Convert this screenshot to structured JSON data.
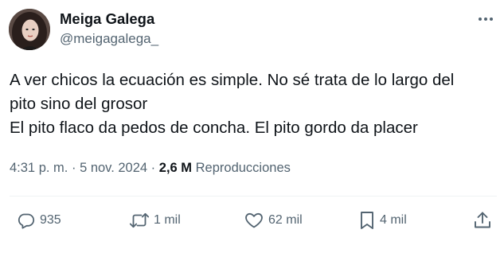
{
  "author": {
    "display_name": "Meiga Galega",
    "handle": "@meigagalega_"
  },
  "post": {
    "lines": [
      "A ver chicos la ecuación es simple. No sé trata de lo largo del",
      "pito sino del grosor",
      "El pito flaco da pedos de concha. El pito gordo da placer"
    ]
  },
  "meta": {
    "time": "4:31 p. m.",
    "separator": "·",
    "date": "5 nov. 2024",
    "views_count": "2,6 M",
    "views_label": "Reproducciones"
  },
  "actions": {
    "replies": "935",
    "reposts": "1 mil",
    "likes": "62 mil",
    "bookmarks": "4 mil"
  },
  "icons": {
    "more": "more-horizontal-icon",
    "reply": "reply-bubble-icon",
    "repost": "repost-arrows-icon",
    "like": "heart-icon",
    "bookmark": "bookmark-icon",
    "share": "share-upload-icon"
  },
  "colors": {
    "text_primary": "#0f1419",
    "text_secondary": "#536471",
    "divider": "#eff3f4"
  }
}
